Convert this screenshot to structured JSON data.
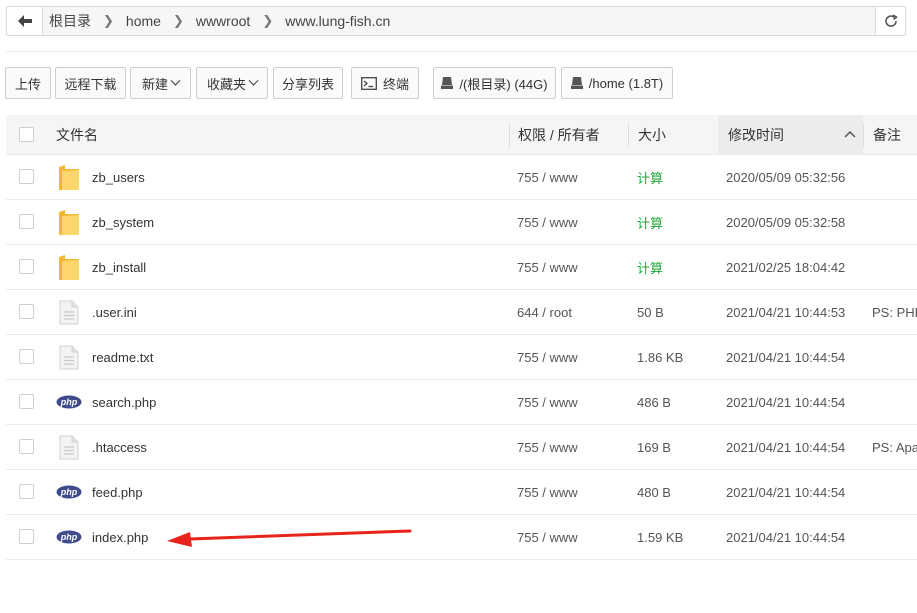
{
  "pathbar": {
    "crumbs": [
      "根目录",
      "home",
      "wwwroot",
      "www.lung-fish.cn"
    ]
  },
  "toolbar": {
    "upload": "上传",
    "remote_download": "远程下载",
    "new": "新建",
    "favorites": "收藏夹",
    "share_list": "分享列表",
    "terminal": "终端",
    "disk_root": "/(根目录) (44G)",
    "disk_home": "/home (1.8T)"
  },
  "table": {
    "headers": {
      "name": "文件名",
      "perm": "权限 / 所有者",
      "size": "大小",
      "mtime": "修改时间",
      "note": "备注"
    },
    "rows": [
      {
        "icon": "folder",
        "name": "zb_users",
        "perm": "755 / www",
        "size": "计算",
        "size_is_calc": true,
        "mtime": "2020/05/09 05:32:56",
        "note": ""
      },
      {
        "icon": "folder",
        "name": "zb_system",
        "perm": "755 / www",
        "size": "计算",
        "size_is_calc": true,
        "mtime": "2020/05/09 05:32:58",
        "note": ""
      },
      {
        "icon": "folder",
        "name": "zb_install",
        "perm": "755 / www",
        "size": "计算",
        "size_is_calc": true,
        "mtime": "2021/02/25 18:04:42",
        "note": ""
      },
      {
        "icon": "text-file",
        "name": ".user.ini",
        "perm": "644 / root",
        "size": "50 B",
        "size_is_calc": false,
        "mtime": "2021/04/21 10:44:53",
        "note": "PS: PHP"
      },
      {
        "icon": "text-file",
        "name": "readme.txt",
        "perm": "755 / www",
        "size": "1.86 KB",
        "size_is_calc": false,
        "mtime": "2021/04/21 10:44:54",
        "note": ""
      },
      {
        "icon": "php-file",
        "name": "search.php",
        "perm": "755 / www",
        "size": "486 B",
        "size_is_calc": false,
        "mtime": "2021/04/21 10:44:54",
        "note": ""
      },
      {
        "icon": "text-file",
        "name": ".htaccess",
        "perm": "755 / www",
        "size": "169 B",
        "size_is_calc": false,
        "mtime": "2021/04/21 10:44:54",
        "note": "PS: Apac"
      },
      {
        "icon": "php-file",
        "name": "feed.php",
        "perm": "755 / www",
        "size": "480 B",
        "size_is_calc": false,
        "mtime": "2021/04/21 10:44:54",
        "note": ""
      },
      {
        "icon": "php-file",
        "name": "index.php",
        "perm": "755 / www",
        "size": "1.59 KB",
        "size_is_calc": false,
        "mtime": "2021/04/21 10:44:54",
        "note": ""
      }
    ]
  },
  "php_badge_text": "php",
  "annotation": {
    "arrow_color": "#e8231c",
    "points_to": "index.php"
  },
  "colors": {
    "calc_link": "#20a53a",
    "folder": "#f7c84b",
    "php_badge": "#3f4b8c"
  }
}
